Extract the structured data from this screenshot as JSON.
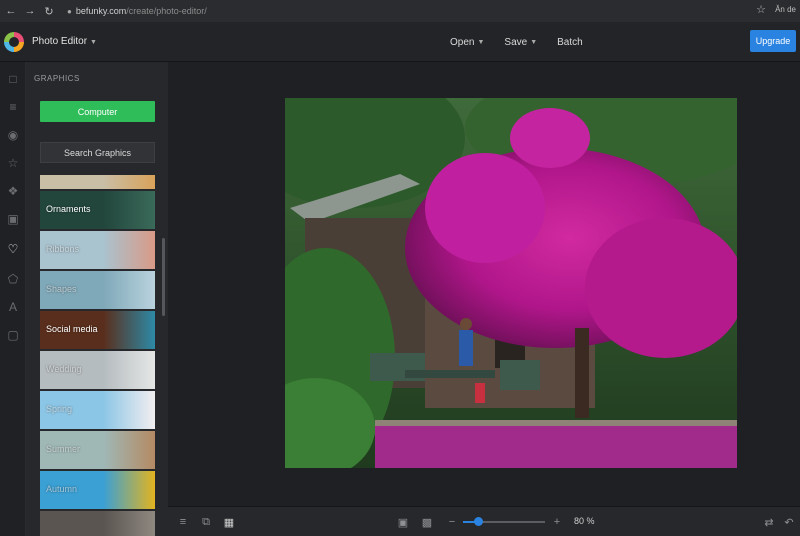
{
  "browser": {
    "url_host": "befunky.com",
    "url_path": "/create/photo-editor/",
    "profile_text": "Ăn de"
  },
  "app": {
    "title": "Photo Editor",
    "menu": [
      {
        "label": "Open"
      },
      {
        "label": "Save"
      },
      {
        "label": "Batch"
      }
    ],
    "upgrade_label": "Upgrade"
  },
  "panel": {
    "title": "GRAPHICS",
    "computer_label": "Computer",
    "search_label": "Search Graphics",
    "categories": [
      {
        "label": "",
        "colors": [
          "#c9bfa6",
          "#d9a25a"
        ],
        "faded": false
      },
      {
        "label": "Ornaments",
        "colors": [
          "#22463c",
          "#3a6a5a"
        ],
        "faded": false
      },
      {
        "label": "Ribbons",
        "colors": [
          "#a9c3cf",
          "#d99a87"
        ],
        "faded": true
      },
      {
        "label": "Shapes",
        "colors": [
          "#7fa8b8",
          "#b9d3de"
        ],
        "faded": true
      },
      {
        "label": "Social media",
        "colors": [
          "#5a2e1c",
          "#2d8aa6"
        ],
        "faded": false
      },
      {
        "label": "Wedding",
        "colors": [
          "#b5bcbf",
          "#e5e7e6"
        ],
        "faded": true
      },
      {
        "label": "Spring",
        "colors": [
          "#8cc6e6",
          "#f2eef0"
        ],
        "faded": true
      },
      {
        "label": "Summer",
        "colors": [
          "#9fb8b6",
          "#b58a63"
        ],
        "faded": true
      },
      {
        "label": "Autumn",
        "colors": [
          "#3ba0d4",
          "#e2b420"
        ],
        "faded": true
      },
      {
        "label": "",
        "colors": [
          "#5a5550",
          "#8e8880"
        ],
        "faded": false
      }
    ]
  },
  "rail_icons": [
    "layers-icon",
    "adjust-icon",
    "eye-icon",
    "star-icon",
    "frame-icon",
    "texture-icon",
    "heart-icon",
    "shape-icon",
    "text-icon",
    "layout-icon"
  ],
  "zoom": {
    "value_label": "80 %",
    "level": 0.18
  },
  "colors": {
    "accent": "#2a83e0",
    "computer_button": "#2fbd5a"
  }
}
